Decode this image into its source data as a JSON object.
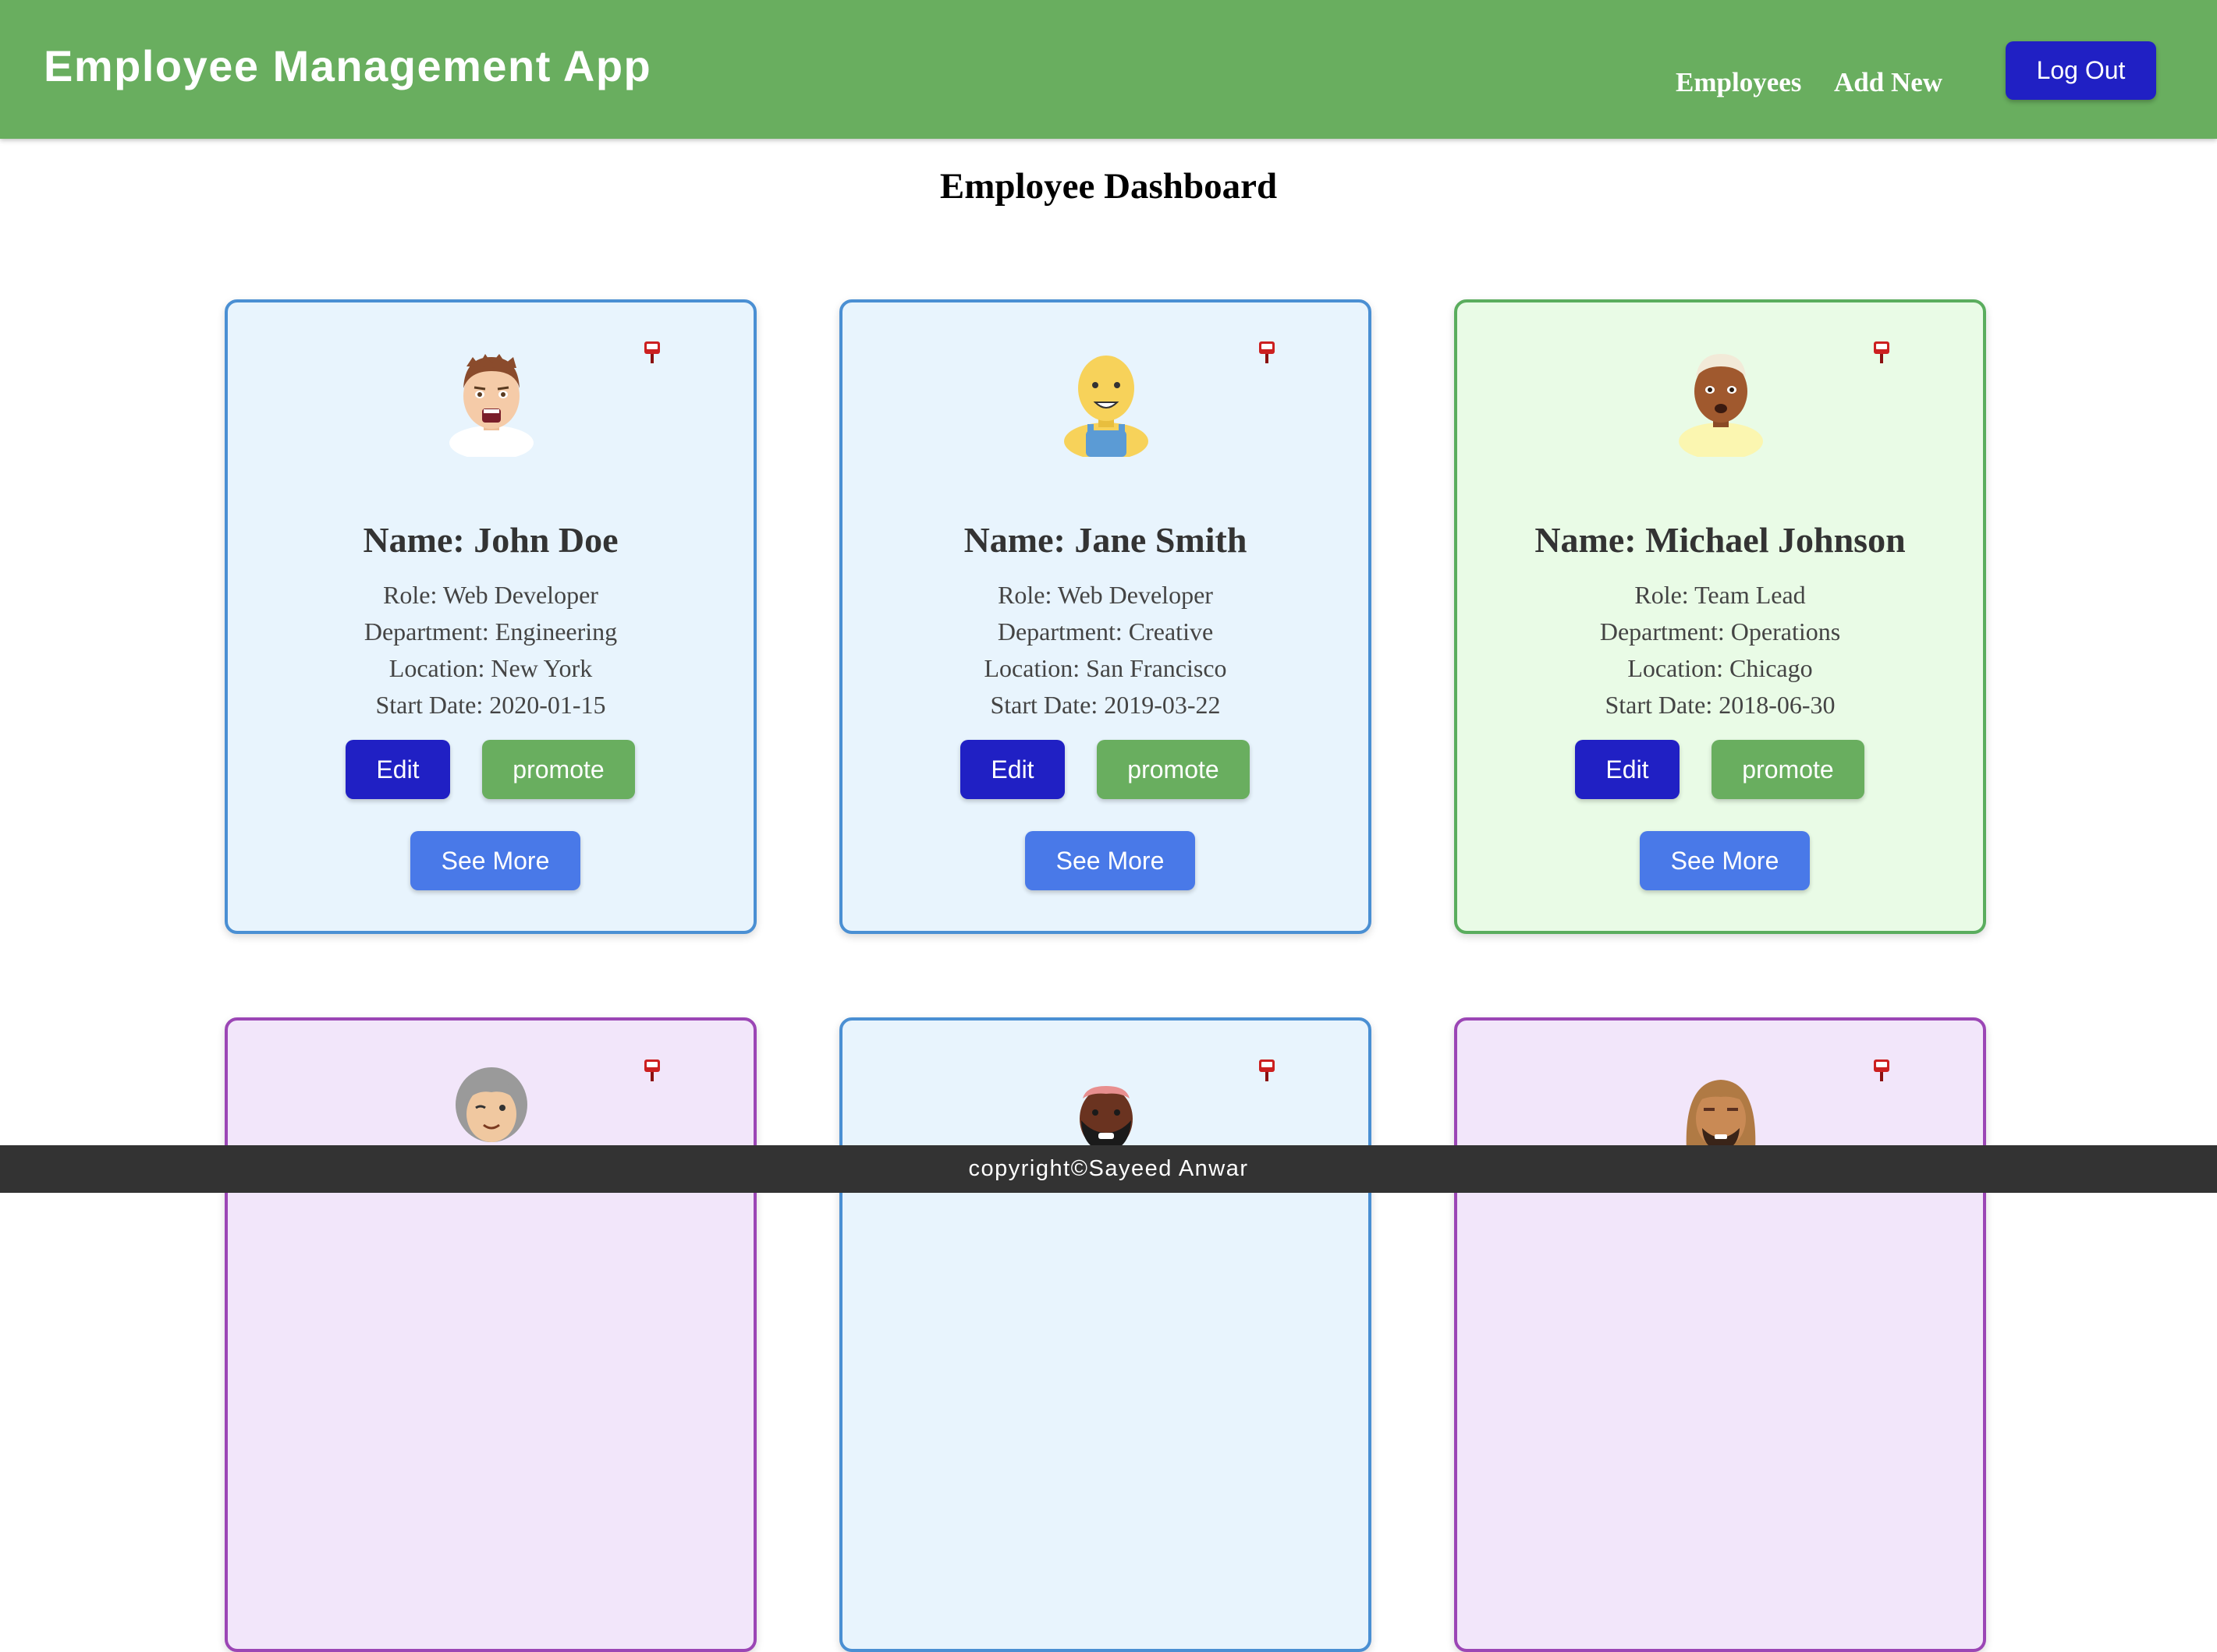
{
  "header": {
    "title": "Employee Management App",
    "nav": [
      "Employees",
      "Add New"
    ],
    "logout_label": "Log Out"
  },
  "page_title": "Employee Dashboard",
  "cards": [
    {
      "name": "Name: John Doe",
      "role": "Role: Web Developer",
      "department": "Department: Engineering",
      "location": "Location: New York",
      "start_date": "Start Date: 2020-01-15",
      "edit_label": "Edit",
      "promote_label": "promote",
      "more_label": "See More",
      "avatar": "man-short-brown-hair-avatar",
      "theme": "blue"
    },
    {
      "name": "Name: Jane Smith",
      "role": "Role: Web Developer",
      "department": "Department: Creative",
      "location": "Location: San Francisco",
      "start_date": "Start Date: 2019-03-22",
      "edit_label": "Edit",
      "promote_label": "promote",
      "more_label": "See More",
      "avatar": "bald-overalls-avatar",
      "theme": "blue"
    },
    {
      "name": "Name: Michael Johnson",
      "role": "Role: Team Lead",
      "department": "Department: Operations",
      "location": "Location: Chicago",
      "start_date": "Start Date: 2018-06-30",
      "edit_label": "Edit",
      "promote_label": "promote",
      "more_label": "See More",
      "avatar": "man-white-hair-avatar",
      "theme": "green"
    },
    {
      "avatar": "woman-gray-hair-avatar",
      "theme": "purple"
    },
    {
      "avatar": "man-beard-avatar",
      "theme": "blue"
    },
    {
      "avatar": "man-long-hair-beard-avatar",
      "theme": "purple"
    }
  ],
  "icons": {
    "pin": "pushpin-icon"
  },
  "colors": {
    "header": "#69ae5f",
    "edit": "#2020c4",
    "promote": "#69ae5f",
    "see_more": "#4979e8",
    "footer": "#333333"
  },
  "footer": {
    "text": "copyright©Sayeed Anwar"
  }
}
